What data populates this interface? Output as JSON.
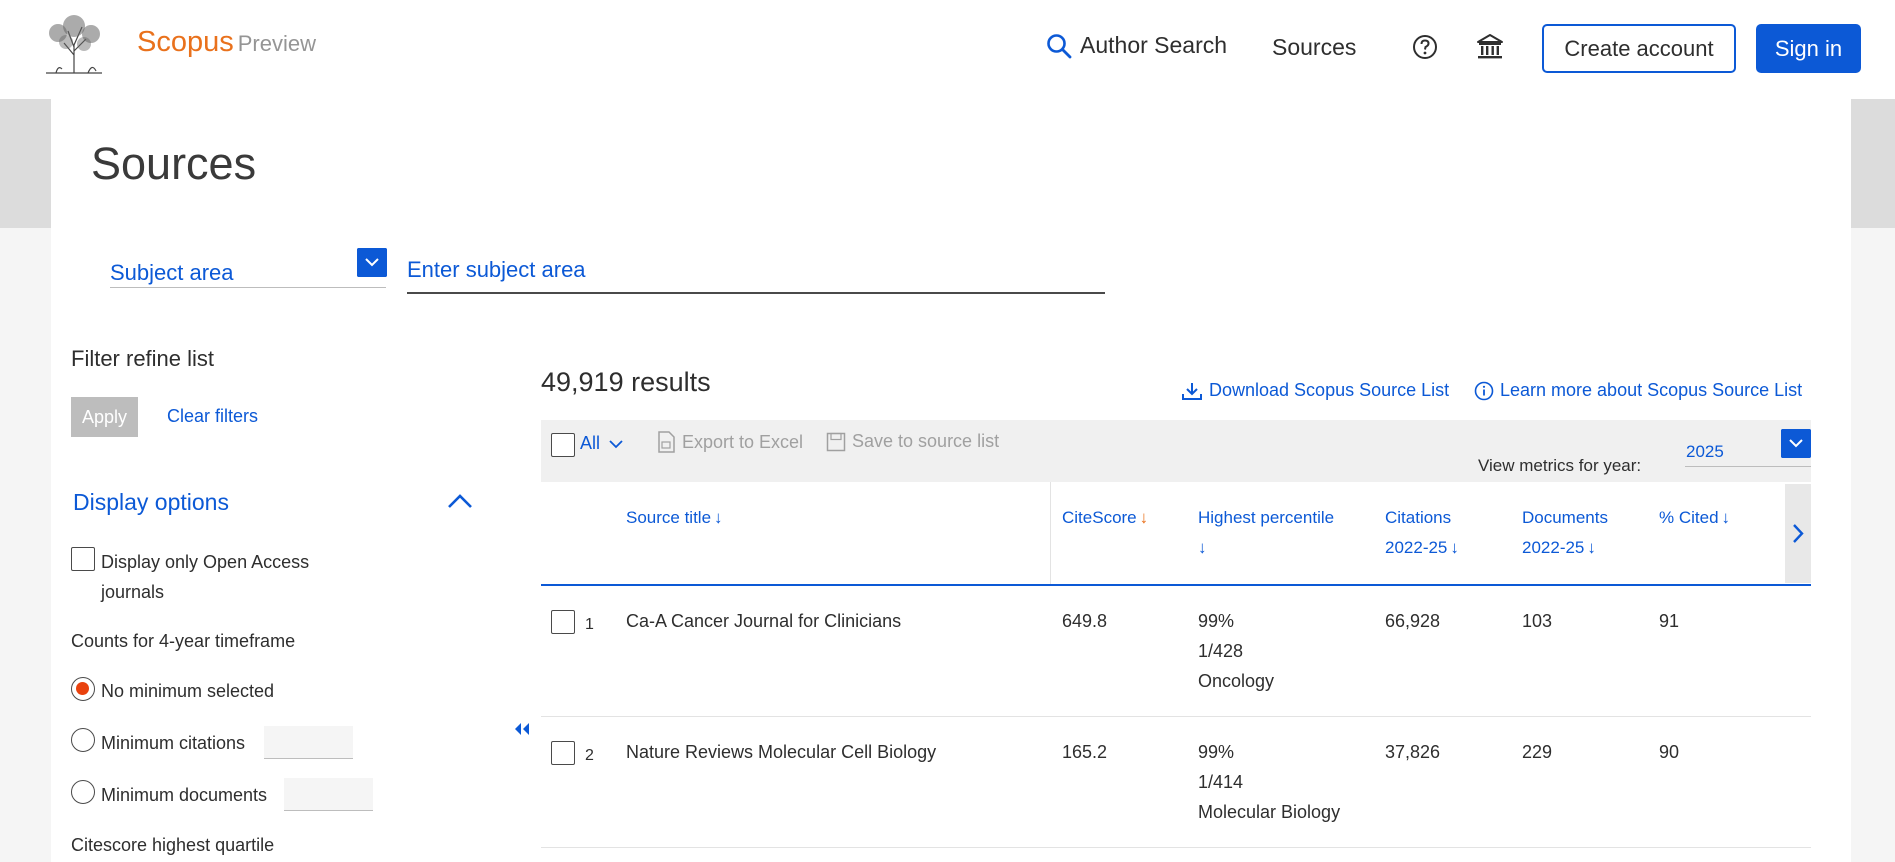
{
  "header": {
    "brand": "Scopus",
    "brand_sub": "Preview",
    "nav_author": "Author Search",
    "nav_sources": "Sources",
    "create_account": "Create account",
    "sign_in": "Sign in"
  },
  "page": {
    "title": "Sources",
    "subject_selector": "Subject area",
    "subject_placeholder": "Enter subject area"
  },
  "sidebar": {
    "filter_title": "Filter refine list",
    "apply": "Apply",
    "clear": "Clear filters",
    "display_options": "Display options",
    "open_access_line1": "Display only Open Access",
    "open_access_line2": "journals",
    "counts_label": "Counts for 4-year timeframe",
    "no_minimum": "No minimum selected",
    "min_citations": "Minimum citations",
    "min_documents": "Minimum documents",
    "citescore_quartile": "Citescore highest quartile"
  },
  "results": {
    "count": "49,919 results",
    "download": "Download Scopus Source List",
    "learn_more": "Learn more about Scopus Source List",
    "select_all": "All",
    "export": "Export to Excel",
    "save": "Save to source list",
    "view_metrics": "View metrics for year:",
    "year": "2025",
    "columns": {
      "source_title": "Source title",
      "citescore": "CiteScore",
      "highest_percentile": "Highest percentile",
      "citations": "Citations",
      "citations_years": "2022-25",
      "documents": "Documents",
      "documents_years": "2022-25",
      "cited": "% Cited"
    },
    "rows": [
      {
        "num": "1",
        "title": "Ca-A Cancer Journal for Clinicians",
        "citescore": "649.8",
        "pct": "99%",
        "rank": "1/428",
        "field": "Oncology",
        "citations": "66,928",
        "documents": "103",
        "cited": "91"
      },
      {
        "num": "2",
        "title": "Nature Reviews Molecular Cell Biology",
        "citescore": "165.2",
        "pct": "99%",
        "rank": "1/414",
        "field": "Molecular Biology",
        "citations": "37,826",
        "documents": "229",
        "cited": "90"
      }
    ]
  },
  "colors": {
    "accent": "#0c59d6",
    "brand": "#e9711c",
    "sort_active": "#e9711c",
    "radio_on": "#e9420e"
  }
}
